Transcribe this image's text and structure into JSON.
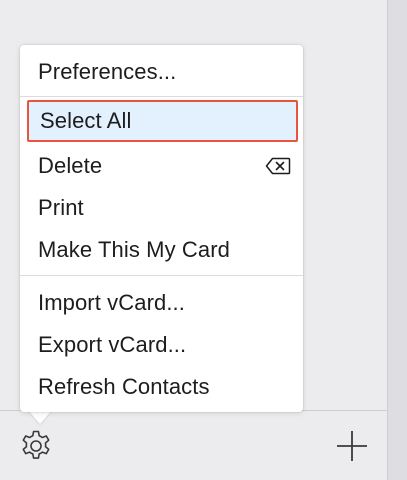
{
  "menu": {
    "items": [
      {
        "label": "Preferences..."
      },
      {
        "label": "Select All",
        "selected": true
      },
      {
        "label": "Delete",
        "shortcut_icon": "delete-backward-icon"
      },
      {
        "label": "Print"
      },
      {
        "label": "Make This My Card"
      },
      {
        "label": "Import vCard..."
      },
      {
        "label": "Export vCard..."
      },
      {
        "label": "Refresh Contacts"
      }
    ]
  },
  "toolbar": {
    "settings_icon": "gear-icon",
    "add_icon": "plus-icon"
  },
  "colors": {
    "selection_fill": "#e3f0fd",
    "selection_border": "#e8553f",
    "text": "#1d1d1f"
  }
}
